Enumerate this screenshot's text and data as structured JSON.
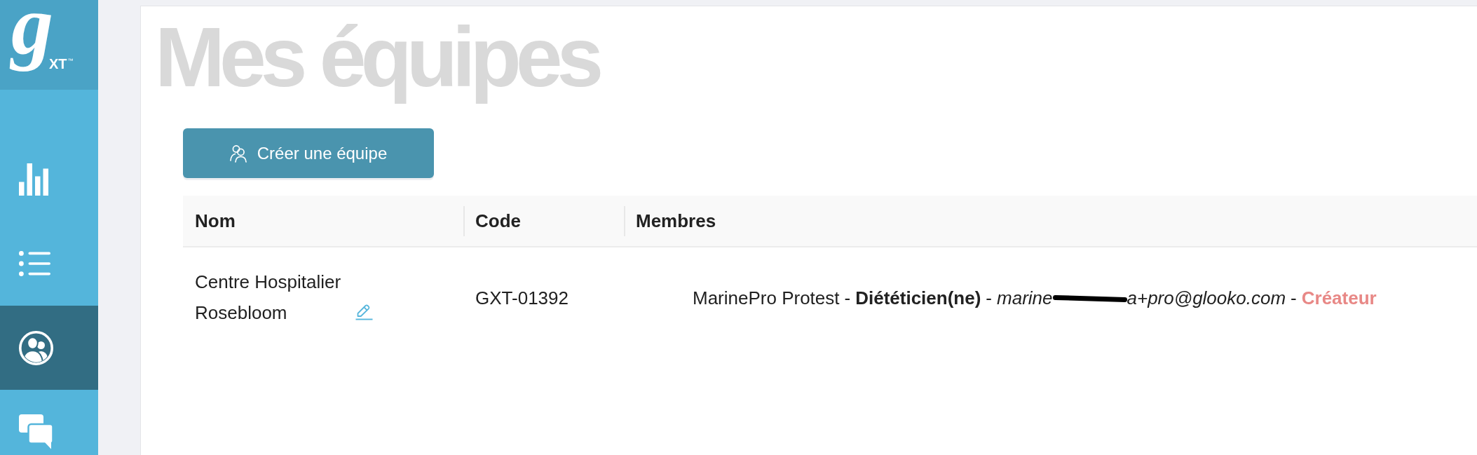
{
  "sidebar": {
    "logo": {
      "letter": "g",
      "suffix": "XT",
      "trademark": "™"
    },
    "items": [
      {
        "selected": false
      },
      {
        "selected": false
      },
      {
        "selected": true
      },
      {
        "selected": false
      }
    ]
  },
  "page": {
    "title": "Mes équipes",
    "create_button": "Créer une équipe"
  },
  "table": {
    "columns": [
      "Nom",
      "Code",
      "Membres"
    ],
    "rows": [
      {
        "name": "Centre Hospitalier Rosebloom",
        "code": "GXT-01392",
        "members": [
          {
            "parts": [
              {
                "kind": "name",
                "text": "MarinePro Protest"
              },
              {
                "kind": "separator",
                "text": "-"
              },
              {
                "kind": "role",
                "text": "Diététicien(ne)"
              },
              {
                "kind": "separator",
                "text": "-"
              },
              {
                "kind": "email",
                "text": "marine"
              },
              {
                "kind": "redaction"
              },
              {
                "kind": "email",
                "text": "a+pro@glooko.com"
              },
              {
                "kind": "separator",
                "text": "-"
              },
              {
                "kind": "status",
                "text": "Créateur"
              }
            ]
          }
        ]
      }
    ]
  }
}
